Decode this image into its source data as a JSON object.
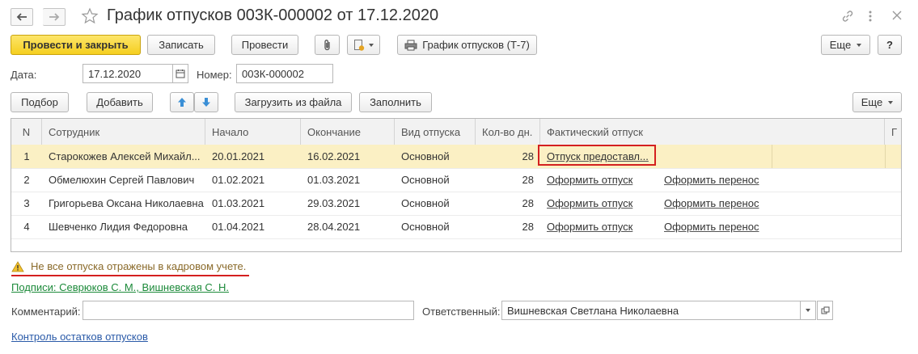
{
  "window": {
    "title": "График отпусков 003К-000002 от 17.12.2020"
  },
  "toolbar": {
    "post_and_close": "Провести и закрыть",
    "save": "Записать",
    "post": "Провести",
    "print_t7": "График отпусков (Т-7)",
    "more": "Еще",
    "help": "?"
  },
  "header_fields": {
    "date_label": "Дата:",
    "date_value": "17.12.2020",
    "number_label": "Номер:",
    "number_value": "003К-000002"
  },
  "table_toolbar": {
    "select": "Подбор",
    "add": "Добавить",
    "load_from_file": "Загрузить из файла",
    "fill": "Заполнить",
    "more": "Еще"
  },
  "table": {
    "columns": [
      "N",
      "Сотрудник",
      "Начало",
      "Окончание",
      "Вид отпуска",
      "Кол-во дн.",
      "Фактический отпуск",
      "Г"
    ],
    "rows": [
      {
        "n": "1",
        "employee": "Старокожев Алексей Михайл...",
        "start": "20.01.2021",
        "end": "16.02.2021",
        "type": "Основной",
        "days": "28",
        "actual": "Отпуск предоставл...",
        "transfer": ""
      },
      {
        "n": "2",
        "employee": "Обмелюхин Сергей Павлович",
        "start": "01.02.2021",
        "end": "01.03.2021",
        "type": "Основной",
        "days": "28",
        "actual": "Оформить отпуск",
        "transfer": "Оформить перенос"
      },
      {
        "n": "3",
        "employee": "Григорьева Оксана Николаевна",
        "start": "01.03.2021",
        "end": "29.03.2021",
        "type": "Основной",
        "days": "28",
        "actual": "Оформить отпуск",
        "transfer": "Оформить перенос"
      },
      {
        "n": "4",
        "employee": "Шевченко Лидия Федоровна",
        "start": "01.04.2021",
        "end": "28.04.2021",
        "type": "Основной",
        "days": "28",
        "actual": "Оформить отпуск",
        "transfer": "Оформить перенос"
      }
    ]
  },
  "warning": "Не все отпуска отражены в кадровом учете.",
  "signatures_link": "Подписи: Севрюков С. М., Вишневская С. Н.",
  "footer_fields": {
    "comment_label": "Комментарий:",
    "comment_value": "",
    "responsible_label": "Ответственный:",
    "responsible_value": "Вишневская Светлана Николаевна"
  },
  "balance_link": "Контроль остатков отпусков",
  "colors": {
    "primary_button": "#f5cf1f",
    "selected_row": "#fbf0c4",
    "highlight": "#d42020",
    "green_link": "#1c8a3a",
    "blue_link": "#2a5aa8"
  }
}
